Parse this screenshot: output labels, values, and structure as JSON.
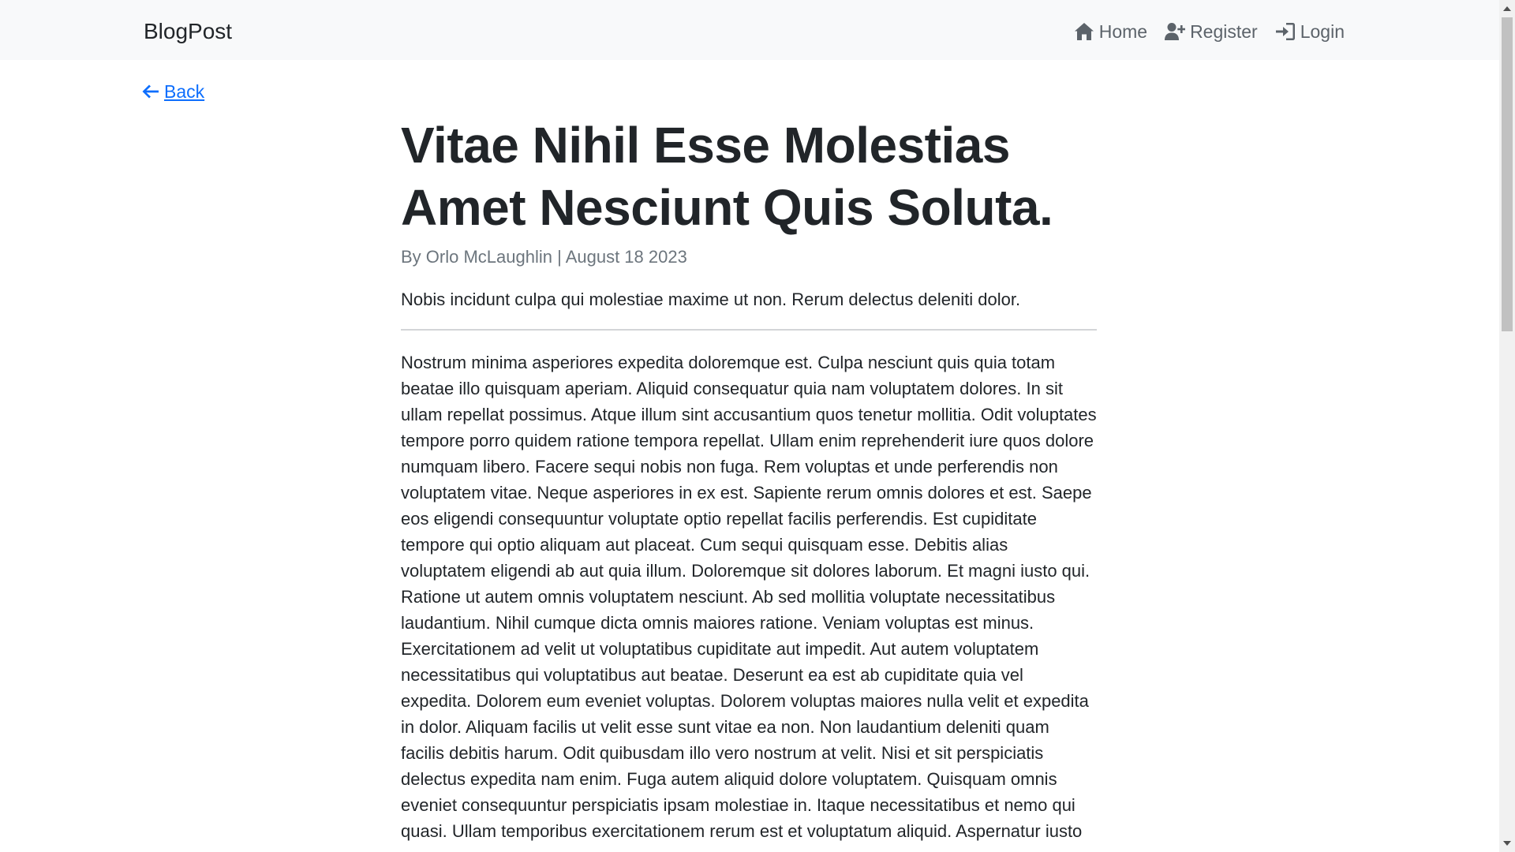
{
  "navbar": {
    "brand": "BlogPost",
    "links": [
      {
        "label": "Home",
        "icon": "home-icon"
      },
      {
        "label": "Register",
        "icon": "user-plus-icon"
      },
      {
        "label": "Login",
        "icon": "sign-in-icon"
      }
    ]
  },
  "back": {
    "label": " Back",
    "icon": "arrow-left-icon"
  },
  "article": {
    "title": "Vitae Nihil Esse Molestias Amet Nesciunt Quis Soluta.",
    "meta": "By Orlo McLaughlin | August 18 2023",
    "summary": "Nobis incidunt culpa qui molestiae maxime ut non. Rerum delectus deleniti dolor.",
    "body": "Nostrum minima asperiores expedita doloremque est. Culpa nesciunt quis quia totam beatae illo quisquam aperiam. Aliquid consequatur quia nam voluptatem dolores. In sit ullam repellat possimus. Atque illum sint accusantium quos tenetur mollitia. Odit voluptates tempore porro quidem ratione tempora repellat. Ullam enim reprehenderit iure quos dolore numquam libero. Facere sequi nobis non fuga. Rem voluptas et unde perferendis non voluptatem vitae. Neque asperiores in ex est. Sapiente rerum omnis dolores et est. Saepe eos eligendi consequuntur voluptate optio repellat facilis perferendis. Est cupiditate tempore qui optio aliquam aut placeat. Cum sequi quisquam esse. Debitis alias voluptatem eligendi ab aut quia illum. Doloremque sit dolores laborum. Et magni iusto qui. Ratione ut autem omnis voluptatem nesciunt. Ab sed mollitia voluptate necessitatibus laudantium. Nihil cumque dicta omnis maiores ratione. Veniam voluptas est minus. Exercitationem ad velit ut voluptatibus cupiditate aut impedit. Aut autem voluptatem necessitatibus qui voluptatibus aut beatae. Deserunt ea est ab cupiditate quia vel expedita. Dolorem eum eveniet voluptas. Dolorem voluptas maiores nulla velit et expedita in dolor. Aliquam facilis ut velit esse sunt vitae ea non. Non laudantium deleniti quam facilis debitis harum. Odit quibusdam illo vero nostrum at velit. Nisi et sit perspiciatis delectus expedita nam enim. Fuga autem aliquid dolore voluptatem. Quisquam omnis eveniet consequuntur perspiciatis ipsam molestiae in. Itaque necessitatibus et nemo qui quasi. Ullam temporibus exercitationem rerum est et voluptatum aliquid. Aspernatur iusto"
  },
  "colors": {
    "navbar_bg": "#f8f9fa",
    "link_blue": "#0d6efd",
    "text": "#212529",
    "muted": "#6c757d"
  }
}
